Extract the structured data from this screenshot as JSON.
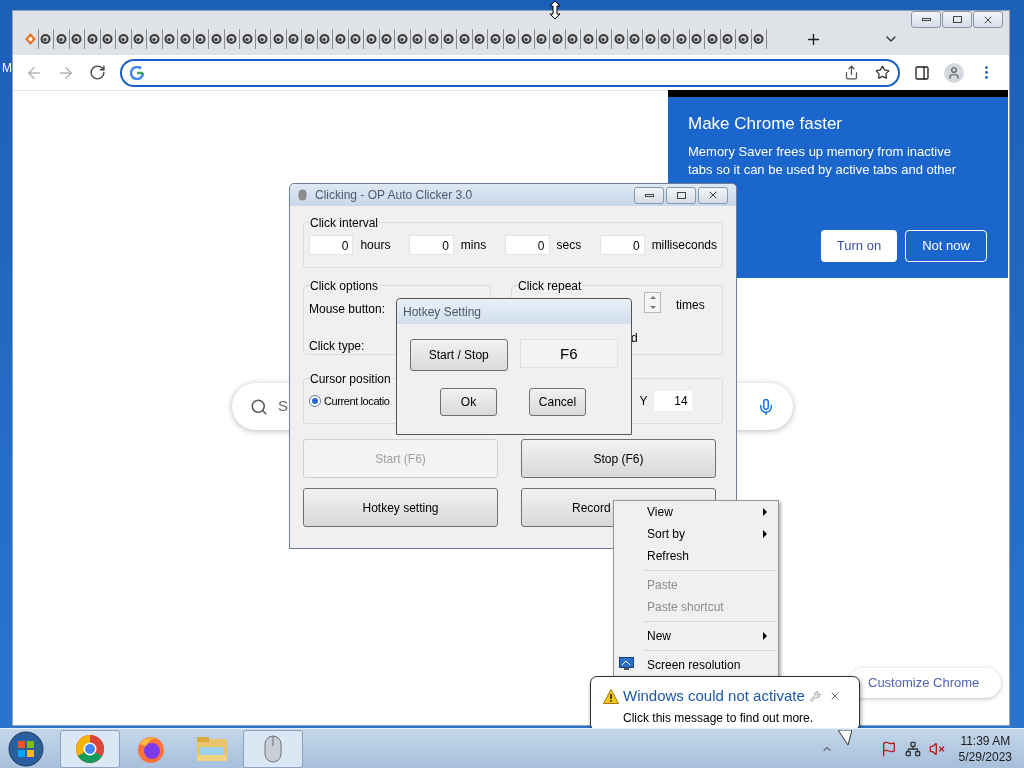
{
  "desktop": {
    "peek_label": "M"
  },
  "browser": {
    "tabs": [
      {
        "kind": "favicon"
      },
      {
        "kind": "page"
      },
      {
        "kind": "page"
      },
      {
        "kind": "page"
      },
      {
        "kind": "page"
      },
      {
        "kind": "page"
      },
      {
        "kind": "page"
      },
      {
        "kind": "page"
      },
      {
        "kind": "page"
      },
      {
        "kind": "page"
      },
      {
        "kind": "page"
      },
      {
        "kind": "page"
      },
      {
        "kind": "page"
      },
      {
        "kind": "page"
      },
      {
        "kind": "page"
      },
      {
        "kind": "page"
      },
      {
        "kind": "page"
      },
      {
        "kind": "page"
      },
      {
        "kind": "page"
      },
      {
        "kind": "page"
      },
      {
        "kind": "page"
      },
      {
        "kind": "page"
      },
      {
        "kind": "page"
      },
      {
        "kind": "page"
      },
      {
        "kind": "page"
      },
      {
        "kind": "page"
      },
      {
        "kind": "page"
      },
      {
        "kind": "page"
      },
      {
        "kind": "page"
      },
      {
        "kind": "page"
      },
      {
        "kind": "page"
      },
      {
        "kind": "page"
      },
      {
        "kind": "page"
      },
      {
        "kind": "page"
      },
      {
        "kind": "page"
      },
      {
        "kind": "page"
      },
      {
        "kind": "page"
      },
      {
        "kind": "page"
      },
      {
        "kind": "page"
      },
      {
        "kind": "page"
      },
      {
        "kind": "page"
      },
      {
        "kind": "page"
      },
      {
        "kind": "page"
      },
      {
        "kind": "page"
      },
      {
        "kind": "page"
      },
      {
        "kind": "page"
      },
      {
        "kind": "page"
      },
      {
        "kind": "page"
      }
    ]
  },
  "memory_popup": {
    "title": "Make Chrome faster",
    "body": "Memory Saver frees up memory from inactive tabs so it can be used by active tabs and other",
    "buttons": [
      {
        "label": "Turn on",
        "kind": "primary"
      },
      {
        "label": "Not now",
        "kind": "outline"
      }
    ]
  },
  "google": {
    "search_placeholder": "S",
    "customize_button": "Customize Chrome"
  },
  "clicker": {
    "title": "Clicking - OP Auto Clicker 3.0",
    "interval": {
      "legend": "Click interval",
      "fields": [
        {
          "value": "0",
          "unit": "hours"
        },
        {
          "value": "0",
          "unit": "mins"
        },
        {
          "value": "0",
          "unit": "secs"
        },
        {
          "value": "0",
          "unit": "milliseconds"
        }
      ]
    },
    "options": {
      "legend": "Click options",
      "labels": [
        "Mouse button:",
        "Click type:"
      ]
    },
    "repeat": {
      "legend": "Click repeat",
      "unit": "times",
      "partial": "d"
    },
    "cursor": {
      "legend": "Cursor position",
      "option": {
        "label": "Current locatio",
        "selected": true
      },
      "y_label": "Y",
      "y_value": "14"
    },
    "buttons": [
      {
        "label": "Start (F6)",
        "disabled": true,
        "kind": "plain"
      },
      {
        "label": "Stop (F6)",
        "disabled": false,
        "kind": "plain"
      },
      {
        "label": "Hotkey setting",
        "disabled": false,
        "kind": "plain"
      },
      {
        "label": "Record",
        "disabled": false,
        "kind": "covered"
      }
    ]
  },
  "hotkey_dialog": {
    "title": "Hotkey Setting",
    "action": "Start / Stop",
    "key": "F6",
    "buttons": [
      "Ok",
      "Cancel"
    ]
  },
  "context_menu": {
    "items": [
      {
        "kind": "item",
        "label": "View",
        "submenu": true,
        "disabled": false
      },
      {
        "kind": "item",
        "label": "Sort by",
        "submenu": true,
        "disabled": false
      },
      {
        "kind": "item",
        "label": "Refresh",
        "submenu": false,
        "disabled": false
      },
      {
        "kind": "separator"
      },
      {
        "kind": "item",
        "label": "Paste",
        "submenu": false,
        "disabled": true
      },
      {
        "kind": "item",
        "label": "Paste shortcut",
        "submenu": false,
        "disabled": true
      },
      {
        "kind": "separator"
      },
      {
        "kind": "item",
        "label": "New",
        "submenu": true,
        "disabled": false
      },
      {
        "kind": "separator"
      },
      {
        "kind": "icon_item",
        "label": "Screen resolution",
        "submenu": false,
        "disabled": false
      }
    ]
  },
  "balloon": {
    "title": "Windows could not activate",
    "message": "Click this message to find out more."
  },
  "taskbar": {
    "apps": [
      {
        "kind": "chrome",
        "selected": true
      },
      {
        "kind": "firefox",
        "selected": false
      },
      {
        "kind": "explorer",
        "selected": false
      },
      {
        "kind": "mouse",
        "selected": true
      }
    ],
    "clock": {
      "time": "11:39 AM",
      "date": "5/29/2023"
    }
  }
}
